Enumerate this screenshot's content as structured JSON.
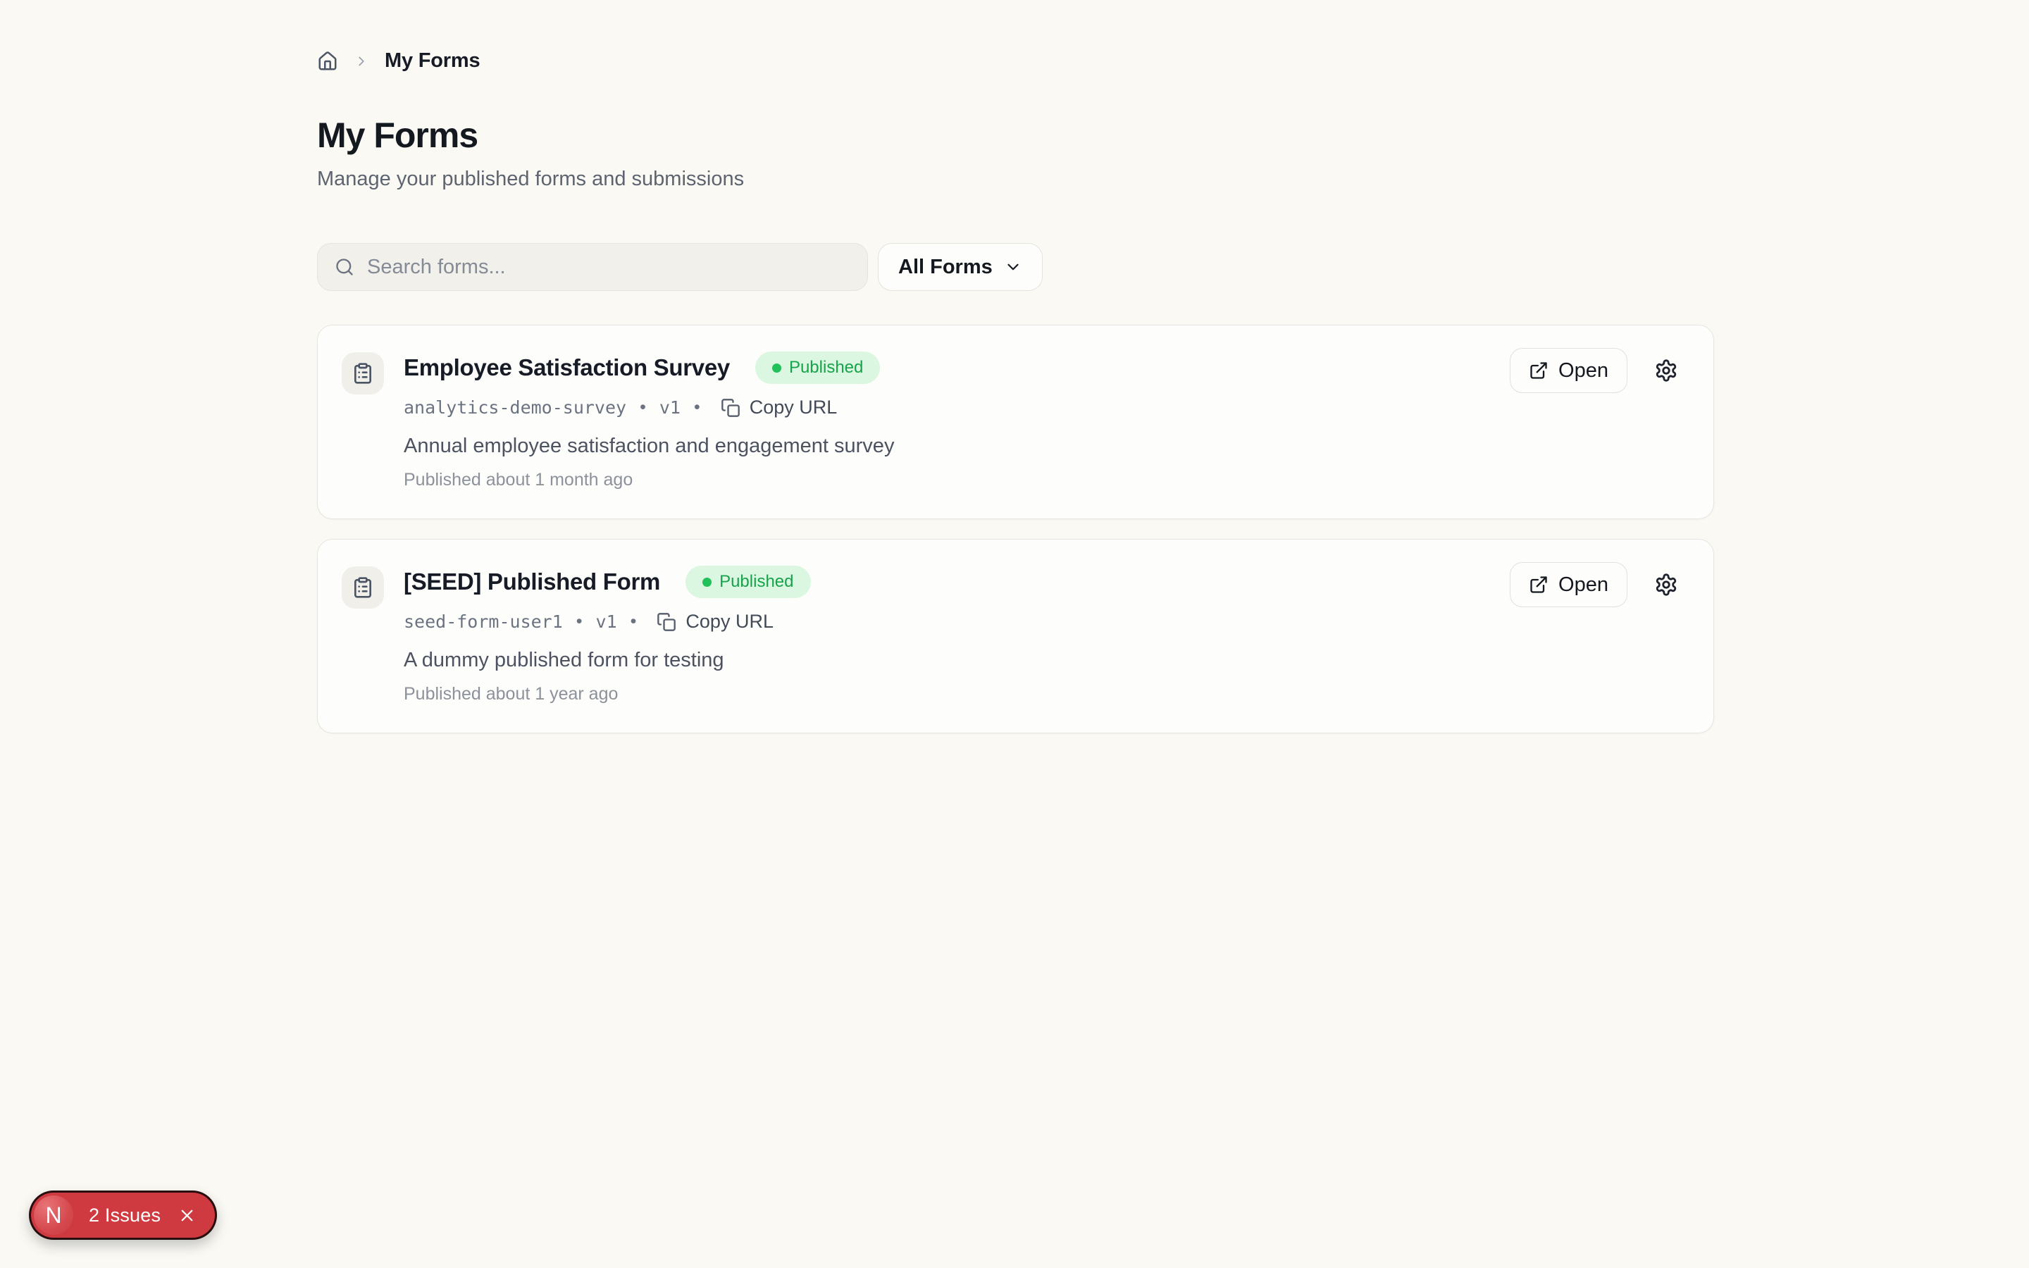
{
  "colors": {
    "page_background": "#FAF9F4",
    "card_background": "#FDFDFB",
    "border": "#E7E5DF",
    "status_published_bg": "#DBF7E1",
    "status_published_text": "#16A34A",
    "status_published_dot": "#22C05B",
    "error_indicator_bg": "#CE3A40",
    "heading_text": "#14181F",
    "muted_text": "#5D6470"
  },
  "breadcrumb": {
    "current": "My Forms"
  },
  "header": {
    "title": "My Forms",
    "subtitle": "Manage your published forms and submissions"
  },
  "toolbar": {
    "search_placeholder": "Search forms...",
    "filter_label": "All Forms"
  },
  "forms": [
    {
      "title": "Employee Satisfaction Survey",
      "status": "Published",
      "slug": "analytics-demo-survey",
      "separator": "•",
      "version": "v1",
      "copy_url_label": "Copy URL",
      "description": "Annual employee satisfaction and engagement survey",
      "published_label": "Published about 1 month ago",
      "open_label": "Open"
    },
    {
      "title": "[SEED] Published Form",
      "status": "Published",
      "slug": "seed-form-user1",
      "separator": "•",
      "version": "v1",
      "copy_url_label": "Copy URL",
      "description": "A dummy published form for testing",
      "published_label": "Published about 1 year ago",
      "open_label": "Open"
    }
  ],
  "dev_indicator": {
    "logo_letter": "N",
    "label": "2 Issues"
  }
}
